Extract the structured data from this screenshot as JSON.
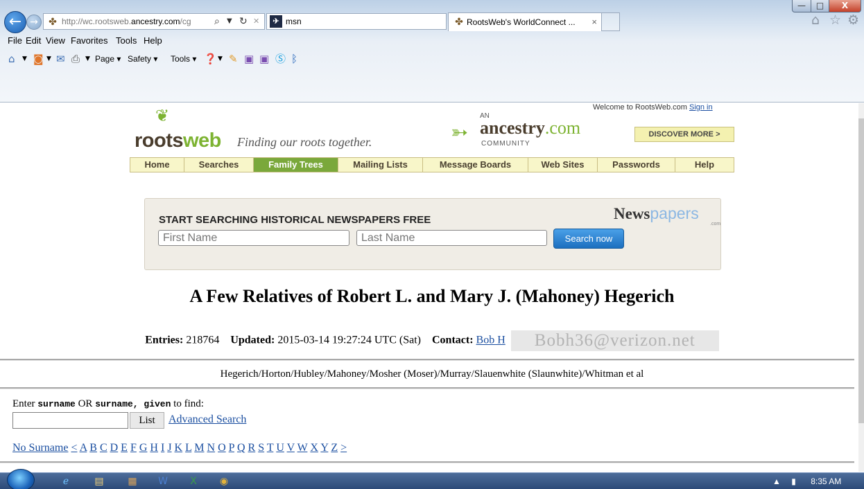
{
  "browser": {
    "address_url_host": "http://wc.rootsweb.",
    "address_url_domain": "ancestry.com",
    "address_url_rest": "/cg",
    "search_provider": "msn",
    "tab_title": "RootsWeb's WorldConnect ...",
    "tab_close": "×",
    "menu": [
      "File",
      "Edit",
      "View",
      "Favorites",
      "Tools",
      "Help"
    ],
    "command_bar": {
      "page": "Page ▾",
      "safety": "Safety ▾",
      "tools": "Tools ▾"
    },
    "window_buttons": {
      "min": "—",
      "max": "□",
      "close": "X"
    }
  },
  "rootsweb": {
    "logo_roots": "roots",
    "logo_web": "web",
    "tagline": "Finding our roots together.",
    "ancestry_an": "AN",
    "ancestry_name": "ancestry",
    "ancestry_com": ".com",
    "ancestry_community": "COMMUNITY",
    "welcome_text": "Welcome to RootsWeb.com",
    "sign_in": "Sign in",
    "discover": "DISCOVER MORE >",
    "nav": [
      "Home",
      "Searches",
      "Family Trees",
      "Mailing Lists",
      "Message Boards",
      "Web Sites",
      "Passwords",
      "Help"
    ],
    "nav_selected": "Family Trees"
  },
  "newspapers": {
    "heading": "START SEARCHING HISTORICAL NEWSPAPERS FREE",
    "brand_bold": "News",
    "brand_light": "papers",
    "brand_suffix": ".com",
    "first_name_placeholder": "First Name",
    "last_name_placeholder": "Last Name",
    "button": "Search now"
  },
  "page": {
    "title": "A Few Relatives of Robert L. and Mary J. (Mahoney) Hegerich",
    "entries_label": "Entries:",
    "entries_value": "218764",
    "updated_label": "Updated:",
    "updated_value": "2015-03-14 19:27:24 UTC (Sat)",
    "contact_label": "Contact:",
    "contact_name": "Bob H",
    "contact_email_image": "Bobh36@verizon.net",
    "surnames": "Hegerich/Horton/Hubley/Mahoney/Mosher (Moser)/Murray/Slauenwhite (Slaunwhite)/Whitman et al",
    "find_pre": "Enter",
    "find_code1": "surname",
    "find_or": "OR",
    "find_code2": "surname, given",
    "find_post": "to find:",
    "list_button": "List",
    "advanced_search": "Advanced Search",
    "alpha_links": [
      "No Surname",
      "<",
      "A",
      "B",
      "C",
      "D",
      "E",
      "F",
      "G",
      "H",
      "I",
      "J",
      "K",
      "L",
      "M",
      "N",
      "O",
      "P",
      "Q",
      "R",
      "S",
      "T",
      "U",
      "V",
      "W",
      "X",
      "Y",
      "Z",
      ">"
    ]
  },
  "taskbar": {
    "time": "8:35 AM",
    "tray_arrow": "▲"
  }
}
